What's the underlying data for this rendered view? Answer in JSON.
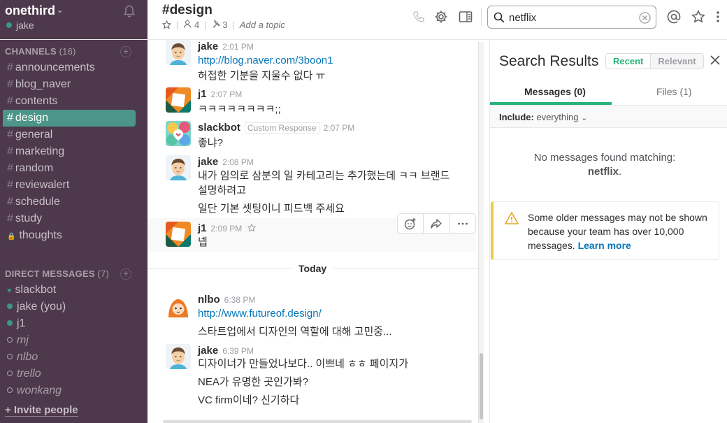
{
  "sidebar": {
    "team_name": "onethird",
    "user_name": "jake",
    "channels_header": "CHANNELS",
    "channels_count": "(16)",
    "channels": [
      {
        "name": "announcements"
      },
      {
        "name": "blog_naver"
      },
      {
        "name": "contents"
      },
      {
        "name": "design",
        "active": true
      },
      {
        "name": "general"
      },
      {
        "name": "marketing"
      },
      {
        "name": "random"
      },
      {
        "name": "reviewalert"
      },
      {
        "name": "schedule"
      },
      {
        "name": "study"
      },
      {
        "name": "thoughts",
        "private": true
      }
    ],
    "dm_header": "DIRECT MESSAGES",
    "dm_count": "(7)",
    "dms": [
      {
        "name": "slackbot",
        "status": "bot"
      },
      {
        "name": "jake (you)",
        "status": "online"
      },
      {
        "name": "j1",
        "status": "online"
      },
      {
        "name": "mj",
        "status": "away"
      },
      {
        "name": "nlbo",
        "status": "away"
      },
      {
        "name": "trello",
        "status": "away"
      },
      {
        "name": "wonkang",
        "status": "away"
      }
    ],
    "invite_label": "+ Invite people"
  },
  "header": {
    "channel_title": "#design",
    "member_count": "4",
    "pinned_count": "3",
    "topic_placeholder": "Add a topic",
    "search_value": "netflix"
  },
  "messages": [
    {
      "author": "jake",
      "time": "2:01 PM",
      "lines": [
        {
          "text": "http://blog.naver.com/3boon1",
          "link": true
        },
        {
          "text": "허접한 기분을 지울수 없다 ㅠ"
        }
      ]
    },
    {
      "author": "j1",
      "time": "2:07 PM",
      "lines": [
        {
          "text": "ㅋㅋㅋㅋㅋㅋㅋㅋ;;"
        }
      ]
    },
    {
      "author": "slackbot",
      "tag": "Custom Response",
      "time": "2:07 PM",
      "lines": [
        {
          "text": "좋냐?"
        }
      ]
    },
    {
      "author": "jake",
      "time": "2:08 PM",
      "lines": [
        {
          "text": "내가 임의로 삼분의 일 카테고리는 추가했는데 ㅋㅋ 브랜드 설명하려고"
        },
        {
          "text": "일단 기본 셋팅이니 피드백 주세요"
        }
      ]
    },
    {
      "author": "j1",
      "time": "2:09 PM",
      "lines": [
        {
          "text": "넵"
        }
      ]
    },
    {
      "author": "nlbo",
      "time": "6:38 PM",
      "lines": [
        {
          "text": "http://www.futureof.design/",
          "link": true
        },
        {
          "text": "스타트업에서 디자인의 역할에 대해 고민중..."
        }
      ]
    },
    {
      "author": "jake",
      "time": "6:39 PM",
      "lines": [
        {
          "text": "디자이너가 만들었나보다.. 이쁘네 ㅎㅎ 페이지가"
        },
        {
          "text": "NEA가 유명한 곳인가봐?"
        },
        {
          "text": "VC firm이네? 신기하다"
        }
      ]
    }
  ],
  "divider_label": "Today",
  "search_pane": {
    "title": "Search Results",
    "sort_recent": "Recent",
    "sort_relevant": "Relevant",
    "tab_messages": "Messages (0)",
    "tab_files": "Files (1)",
    "filter_label": "Include:",
    "filter_value": "everything",
    "empty_text": "No messages found matching:",
    "empty_term": "netflix",
    "warning_text": "Some older messages may not be shown because your team has over 10,000 messages.",
    "warning_link": "Learn more"
  },
  "colors": {
    "sidebar_bg": "#4d394b",
    "active_channel": "#4c9689",
    "accent_green": "#2ab27b",
    "link_blue": "#0576b9",
    "warning_yellow": "#f2c744"
  }
}
